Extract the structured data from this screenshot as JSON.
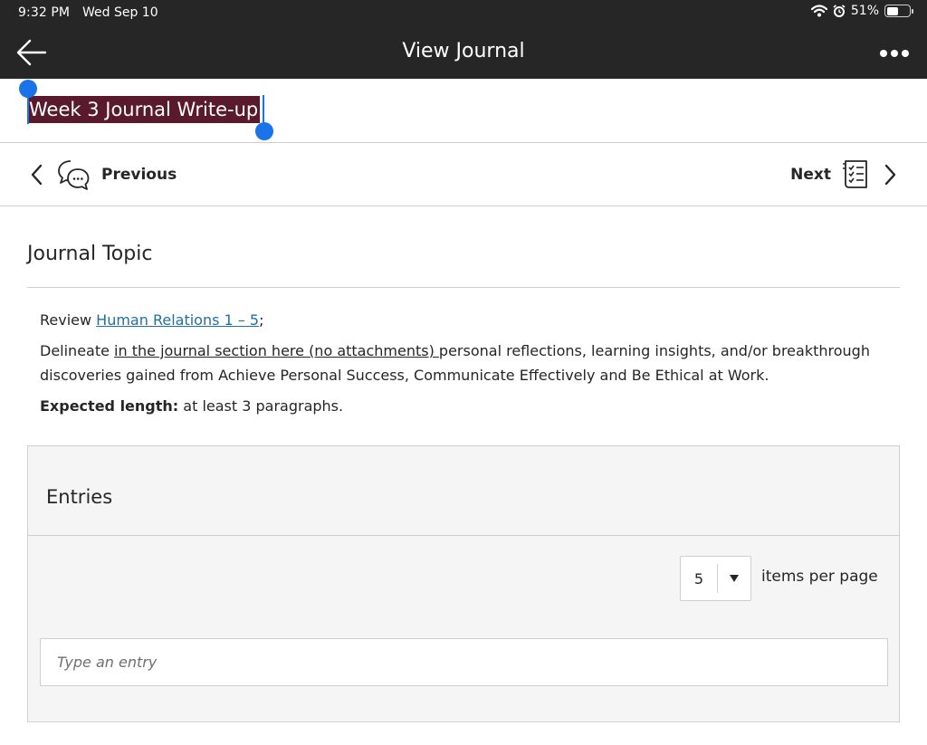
{
  "status_bar": {
    "time": "9:32 PM",
    "date": "Wed Sep 10",
    "battery": "51%",
    "battery_level": 0.51,
    "icons": [
      "wifi-icon",
      "alarm-icon",
      "battery-icon"
    ]
  },
  "header": {
    "title": "View Journal",
    "back_icon": "back-arrow-icon",
    "more_icon": "more-options-icon"
  },
  "journal": {
    "title": "Week 3 Journal Write-up"
  },
  "navigation": {
    "previous_label": "Previous",
    "next_label": "Next",
    "previous_icon": "discussion-icon",
    "next_icon": "checklist-icon"
  },
  "topic": {
    "heading": "Journal Topic",
    "review_prefix": "Review ",
    "review_link": "Human Relations 1 – 5",
    "review_suffix": ";",
    "delineate_prefix": "Delineate ",
    "delineate_underlined": "in the journal section here (no attachments) ",
    "delineate_rest": "personal reflections, learning insights, and/or breakthrough discoveries gained from Achieve Personal Success, Communicate Effectively and Be Ethical at Work.",
    "expected_label": "Expected length:",
    "expected_value": " at least 3 paragraphs."
  },
  "entries": {
    "title": "Entries",
    "per_page_value": "5",
    "per_page_label": "items per page",
    "input_placeholder": "Type an entry"
  },
  "colors": {
    "header_bg": "#262626",
    "selection_highlight": "#5a1a2e",
    "selection_handle": "#1a73e8",
    "link": "#1f6fa8"
  }
}
